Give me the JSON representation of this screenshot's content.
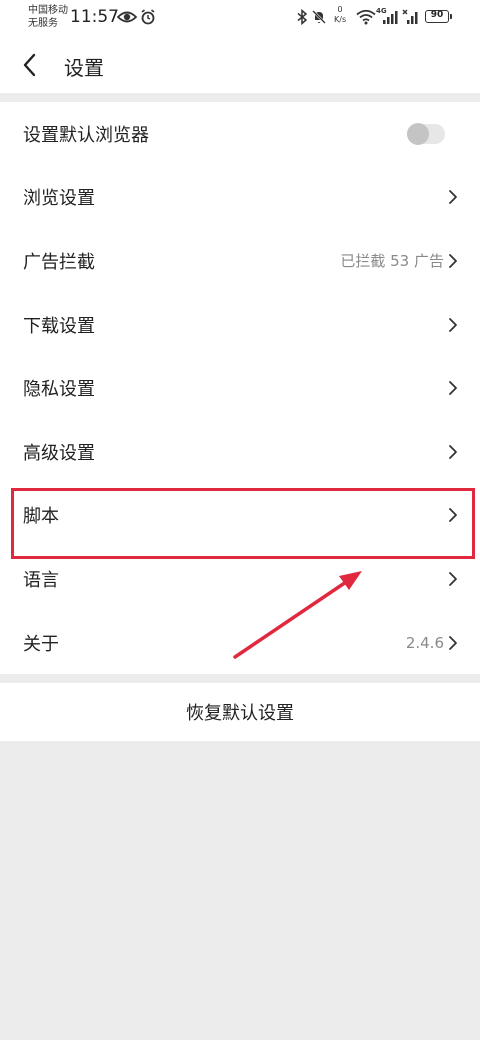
{
  "status_bar": {
    "carrier_line1": "中国移动",
    "carrier_line2": "无服务",
    "time": "11:57",
    "net_speed_value": "0",
    "net_speed_unit": "K/s",
    "network_type": "4G",
    "battery": "90",
    "icons": [
      "eye-icon",
      "alarm-icon",
      "bluetooth-icon",
      "mute-bell-icon",
      "wifi-icon",
      "signal-icon",
      "no-sim-signal-icon"
    ]
  },
  "header": {
    "title": "设置",
    "back_icon": "chevron-left-icon"
  },
  "settings": [
    {
      "label": "设置默认浏览器",
      "control": "toggle",
      "toggle_on": false
    },
    {
      "label": "浏览设置",
      "control": "chevron"
    },
    {
      "label": "广告拦截",
      "value": "已拦截 53 广告",
      "control": "chevron"
    },
    {
      "label": "下载设置",
      "control": "chevron"
    },
    {
      "label": "隐私设置",
      "control": "chevron"
    },
    {
      "label": "高级设置",
      "control": "chevron"
    },
    {
      "label": "脚本",
      "control": "chevron",
      "highlighted": true
    },
    {
      "label": "语言",
      "control": "chevron"
    },
    {
      "label": "关于",
      "value": "2.4.6",
      "control": "chevron"
    }
  ],
  "reset_button": "恢复默认设置",
  "colors": {
    "annotation": "#e0283e",
    "separator": "#ececec",
    "secondary_text": "#8a8a8a"
  }
}
